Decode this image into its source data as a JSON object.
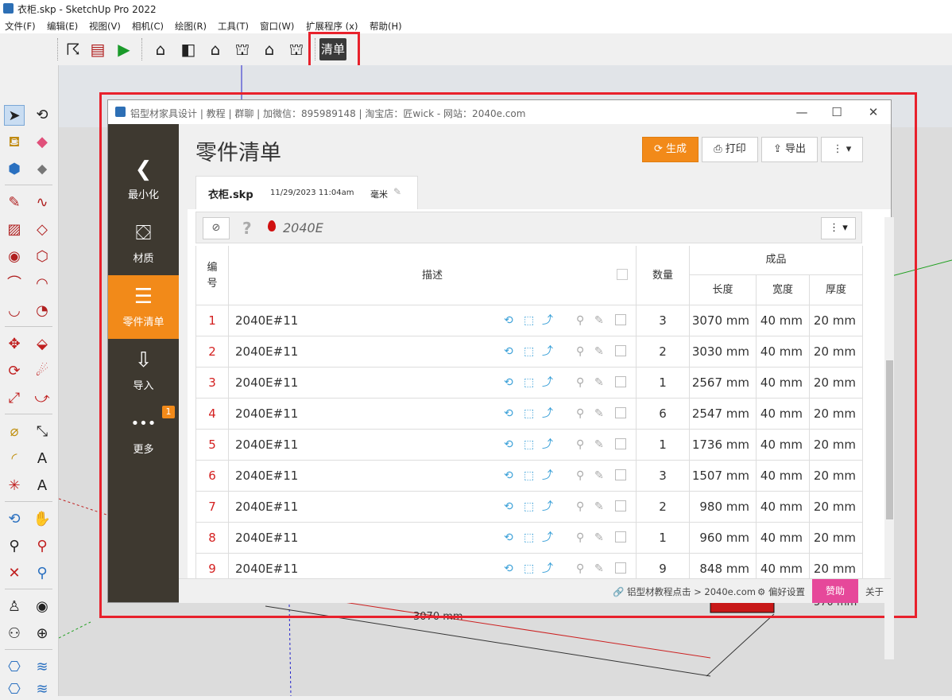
{
  "window": {
    "title": "衣柜.skp - SketchUp Pro 2022"
  },
  "menu": [
    "文件(F)",
    "编辑(E)",
    "视图(V)",
    "相机(C)",
    "绘图(R)",
    "工具(T)",
    "窗口(W)",
    "扩展程序 (x)",
    "帮助(H)"
  ],
  "toolbar": {
    "qingdan_label": "清单"
  },
  "dialog": {
    "title": "铝型材家具设计 | 教程 | 群聊 | 加微信：895989148 | 淘宝店：匠wick - 网站：2040e.com",
    "minimize": "—",
    "maximize": "☐",
    "close": "✕",
    "nav": [
      {
        "icon": "❮",
        "label": "最小化"
      },
      {
        "icon": "⛋",
        "label": "材质"
      },
      {
        "icon": "☰",
        "label": "零件清单"
      },
      {
        "icon": "⇩",
        "label": "导入"
      },
      {
        "icon": "•••",
        "label": "更多",
        "badge": "1"
      }
    ],
    "page_title": "零件清单",
    "buttons": {
      "generate": "⟳ 生成",
      "print": "⎙ 打印",
      "export": "⇪ 导出",
      "more": "⋮ ▾"
    },
    "file_tab": {
      "name": "衣柜.skp",
      "date": "11/29/2023 11:04am",
      "unit": "毫米",
      "edit_icon": "✎"
    },
    "subbar": {
      "eye": "⊘",
      "question": "?",
      "profile": "2040E",
      "more": "⋮ ▾"
    },
    "table": {
      "headers": {
        "no": "编号",
        "desc": "描述",
        "qty": "数量",
        "finished": "成品",
        "length": "长度",
        "width": "宽度",
        "thickness": "厚度"
      },
      "rows": [
        {
          "no": "1",
          "desc": "2040E#11",
          "qty": "3",
          "length": "3070 mm",
          "width": "40 mm",
          "thickness": "20 mm"
        },
        {
          "no": "2",
          "desc": "2040E#11",
          "qty": "2",
          "length": "3030 mm",
          "width": "40 mm",
          "thickness": "20 mm"
        },
        {
          "no": "3",
          "desc": "2040E#11",
          "qty": "1",
          "length": "2567 mm",
          "width": "40 mm",
          "thickness": "20 mm"
        },
        {
          "no": "4",
          "desc": "2040E#11",
          "qty": "6",
          "length": "2547 mm",
          "width": "40 mm",
          "thickness": "20 mm"
        },
        {
          "no": "5",
          "desc": "2040E#11",
          "qty": "1",
          "length": "1736 mm",
          "width": "40 mm",
          "thickness": "20 mm"
        },
        {
          "no": "6",
          "desc": "2040E#11",
          "qty": "3",
          "length": "1507 mm",
          "width": "40 mm",
          "thickness": "20 mm"
        },
        {
          "no": "7",
          "desc": "2040E#11",
          "qty": "2",
          "length": "980 mm",
          "width": "40 mm",
          "thickness": "20 mm"
        },
        {
          "no": "8",
          "desc": "2040E#11",
          "qty": "1",
          "length": "960 mm",
          "width": "40 mm",
          "thickness": "20 mm"
        },
        {
          "no": "9",
          "desc": "2040E#11",
          "qty": "9",
          "length": "848 mm",
          "width": "40 mm",
          "thickness": "20 mm"
        }
      ]
    },
    "footer": {
      "link": "🔗 铝型材教程点击 > 2040e.com",
      "prefs": "⚙ 偏好设置",
      "sponsor": "赞助",
      "about": "关于"
    }
  },
  "viewport": {
    "dim_label_1": "3070 mm",
    "dim_label_2": "570 mm"
  }
}
